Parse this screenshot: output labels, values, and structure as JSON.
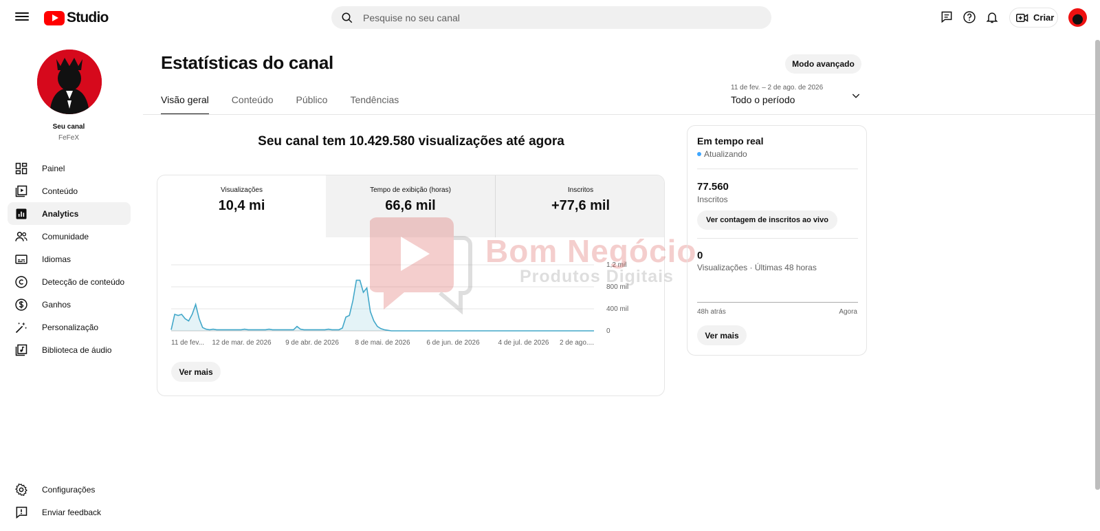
{
  "header": {
    "logo_text": "Studio",
    "search_placeholder": "Pesquise no seu canal",
    "create_label": "Criar"
  },
  "sidebar": {
    "channel_label": "Seu canal",
    "channel_name": "FeFeX",
    "items": [
      {
        "label": "Painel",
        "icon": "dashboard-icon"
      },
      {
        "label": "Conteúdo",
        "icon": "content-icon"
      },
      {
        "label": "Analytics",
        "icon": "analytics-icon",
        "active": true
      },
      {
        "label": "Comunidade",
        "icon": "community-icon"
      },
      {
        "label": "Idiomas",
        "icon": "subtitles-icon"
      },
      {
        "label": "Detecção de conteúdo",
        "icon": "copyright-icon"
      },
      {
        "label": "Ganhos",
        "icon": "dollar-icon"
      },
      {
        "label": "Personalização",
        "icon": "magic-wand-icon"
      },
      {
        "label": "Biblioteca de áudio",
        "icon": "audio-library-icon"
      }
    ],
    "bottom_items": [
      {
        "label": "Configurações",
        "icon": "gear-icon"
      },
      {
        "label": "Enviar feedback",
        "icon": "feedback-icon"
      }
    ]
  },
  "main": {
    "title": "Estatísticas do canal",
    "advanced_mode": "Modo avançado",
    "tabs": [
      "Visão geral",
      "Conteúdo",
      "Público",
      "Tendências"
    ],
    "active_tab": "Visão geral",
    "date_range": {
      "sub": "11 de fev. – 2 de ago. de 2026",
      "main": "Todo o período"
    },
    "headline": "Seu canal tem 10.429.580 visualizações até agora",
    "metrics": [
      {
        "label": "Visualizações",
        "value": "10,4 mi"
      },
      {
        "label": "Tempo de exibição (horas)",
        "value": "66,6 mil"
      },
      {
        "label": "Inscritos",
        "value": "+77,6 mil"
      }
    ],
    "see_more": "Ver mais"
  },
  "chart_data": {
    "type": "area",
    "series": [
      {
        "values": [
          0.02,
          0.3,
          0.28,
          0.3,
          0.22,
          0.18,
          0.3,
          0.48,
          0.22,
          0.06,
          0.03,
          0.02,
          0.03,
          0.02,
          0.02,
          0.02,
          0.02,
          0.02,
          0.02,
          0.02,
          0.02,
          0.03,
          0.02,
          0.02,
          0.02,
          0.02,
          0.02,
          0.02,
          0.03,
          0.02,
          0.02,
          0.02,
          0.02,
          0.02,
          0.02,
          0.02,
          0.08,
          0.03,
          0.02,
          0.02,
          0.02,
          0.02,
          0.02,
          0.02,
          0.02,
          0.03,
          0.02,
          0.02,
          0.02,
          0.05,
          0.25,
          0.28,
          0.55,
          0.92,
          0.92,
          0.7,
          0.78,
          0.35,
          0.18,
          0.08,
          0.04,
          0.02,
          0.01,
          0,
          0,
          0,
          0,
          0,
          0,
          0,
          0,
          0,
          0,
          0,
          0,
          0,
          0,
          0,
          0,
          0,
          0,
          0,
          0,
          0,
          0,
          0,
          0,
          0,
          0,
          0,
          0,
          0,
          0,
          0,
          0,
          0,
          0,
          0,
          0,
          0,
          0,
          0,
          0,
          0,
          0,
          0,
          0,
          0,
          0,
          0,
          0,
          0,
          0,
          0,
          0,
          0,
          0,
          0,
          0,
          0,
          0,
          0
        ]
      }
    ],
    "x_ticks": [
      "11 de fev...",
      "12 de mar. de 2026",
      "9 de abr. de 2026",
      "8 de mai. de 2026",
      "6 de jun. de 2026",
      "4 de jul. de 2026",
      "2 de ago...."
    ],
    "y_ticks": [
      "1,2 mil",
      "800 mil",
      "400 mil",
      "0"
    ],
    "ylim": [
      0,
      1.2
    ],
    "grid": true,
    "color": "#41a7c9"
  },
  "realtime": {
    "title": "Em tempo real",
    "status": "Atualizando",
    "subscribers": "77.560",
    "subscribers_label": "Inscritos",
    "live_button": "Ver contagem de inscritos ao vivo",
    "views": "0",
    "views_label": "Visualizações · Últimas 48 horas",
    "axis_left": "48h atrás",
    "axis_right": "Agora",
    "see_more": "Ver mais"
  },
  "watermark": {
    "line1": "Bom Negócio",
    "line2": "Produtos Digitais"
  }
}
